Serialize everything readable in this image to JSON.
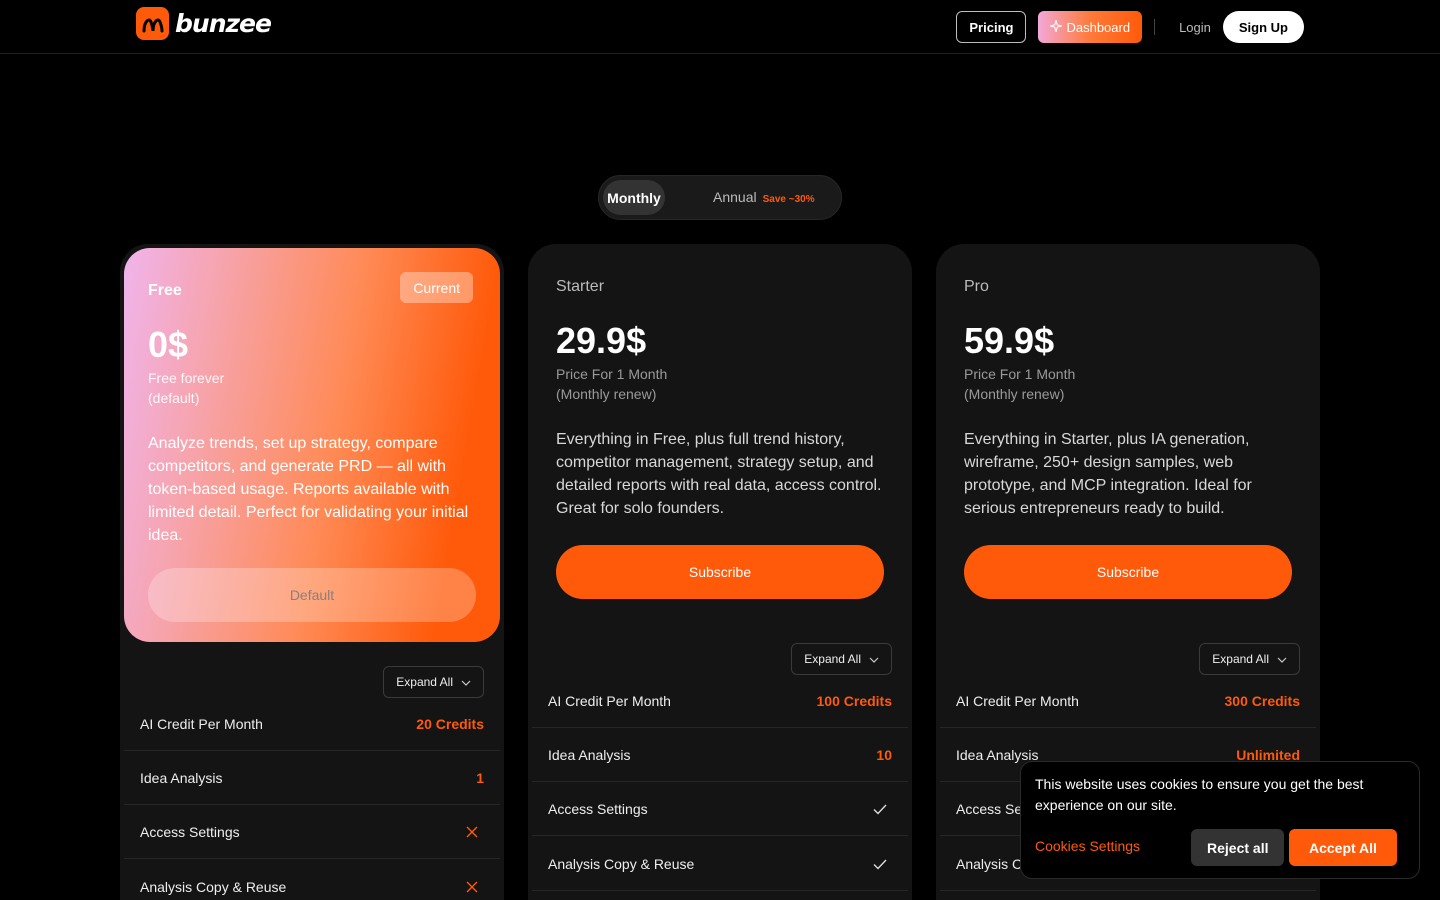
{
  "brand": {
    "name": "bunzee",
    "color": "#ff5a0a"
  },
  "nav": {
    "pricing": "Pricing",
    "dashboard": "Dashboard",
    "login": "Login",
    "signup": "Sign Up"
  },
  "billing_toggle": {
    "monthly": "Monthly",
    "annual": "Annual",
    "save": "Save ~30%",
    "selected": "Monthly"
  },
  "plans": [
    {
      "name": "Free",
      "badge": "Current",
      "price": "0$",
      "sub1": "Free forever",
      "sub2": "(default)",
      "description": "Analyze trends, set up strategy, compare competitors, and generate PRD — all with token-based usage. Reports available with limited detail. Perfect for validating your initial idea.",
      "cta": "Default",
      "expand": "Expand All",
      "features": [
        {
          "label": "AI Credit Per Month",
          "value": "20 Credits"
        },
        {
          "label": "Idea Analysis",
          "value": "1"
        },
        {
          "label": "Access Settings",
          "icon": "x-icon"
        },
        {
          "label": "Analysis Copy & Reuse",
          "icon": "x-icon"
        }
      ]
    },
    {
      "name": "Starter",
      "price": "29.9$",
      "sub1": "Price For 1 Month",
      "sub2": "(Monthly renew)",
      "description": "Everything in Free, plus full trend history, competitor management, strategy setup, and detailed reports with real data, access control. Great for solo founders.",
      "cta": "Subscribe",
      "expand": "Expand All",
      "features": [
        {
          "label": "AI Credit Per Month",
          "value": "100 Credits"
        },
        {
          "label": "Idea Analysis",
          "value": "10"
        },
        {
          "label": "Access Settings",
          "icon": "check-icon"
        },
        {
          "label": "Analysis Copy & Reuse",
          "icon": "check-icon"
        }
      ]
    },
    {
      "name": "Pro",
      "price": "59.9$",
      "sub1": "Price For 1 Month",
      "sub2": "(Monthly renew)",
      "description": "Everything in Starter, plus IA generation, wireframe, 250+ design samples, web prototype, and MCP integration. Ideal for serious entrepreneurs ready to build.",
      "cta": "Subscribe",
      "expand": "Expand All",
      "features": [
        {
          "label": "AI Credit Per Month",
          "value": "300 Credits"
        },
        {
          "label": "Idea Analysis",
          "value": "Unlimited"
        },
        {
          "label": "Access Se"
        },
        {
          "label": "Analysis C"
        }
      ]
    }
  ],
  "cookie": {
    "text": "This website uses cookies to ensure you get the best experience on our site.",
    "settings": "Cookies Settings",
    "reject": "Reject all",
    "accept": "Accept All"
  }
}
